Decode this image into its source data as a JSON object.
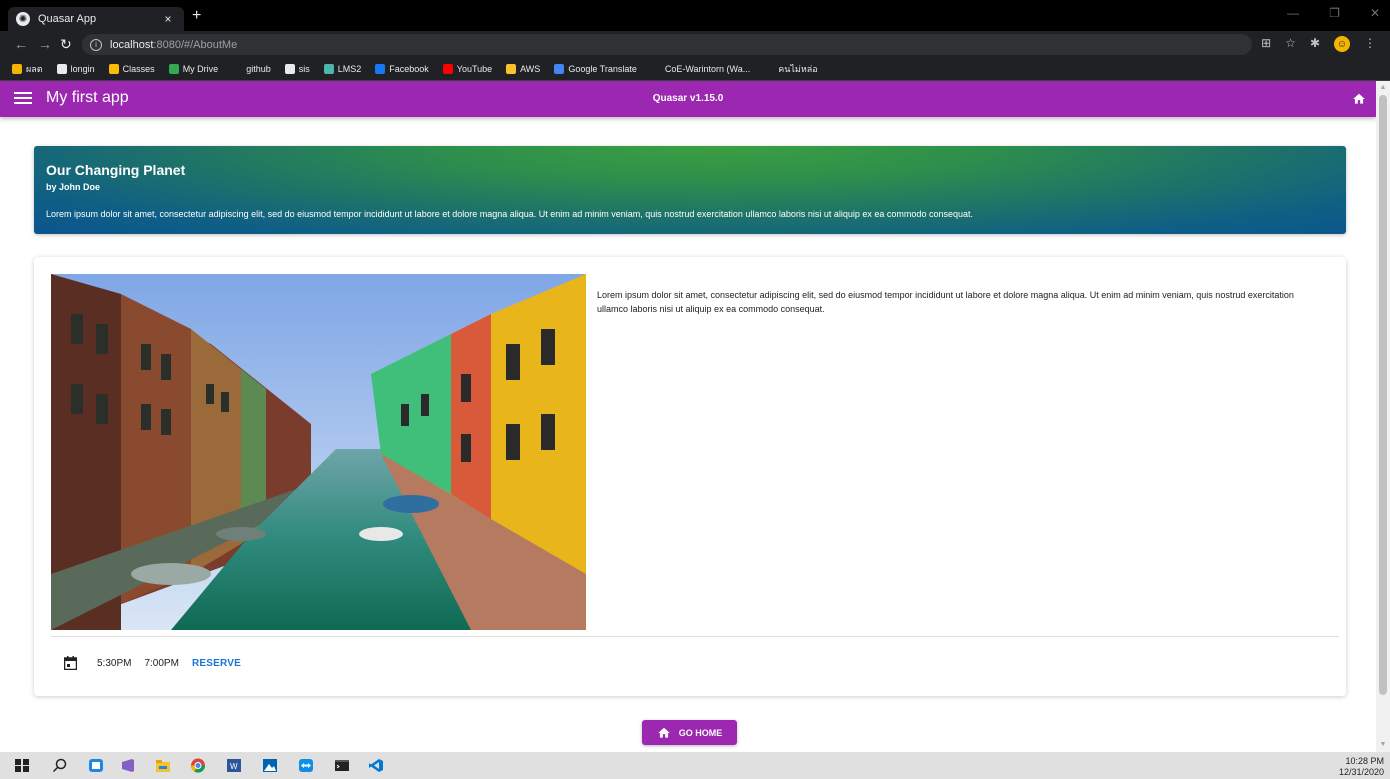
{
  "browser": {
    "tab_title": "Quasar App",
    "tab_close": "×",
    "new_tab": "+",
    "url_host": "localhost",
    "url_rest": ":8080/#/AboutMe",
    "bookmarks": [
      {
        "label": "ผลต",
        "color": "#f4b400"
      },
      {
        "label": "longin",
        "color": "#e8eaed"
      },
      {
        "label": "Classes",
        "color": "#fbbc04"
      },
      {
        "label": "My Drive",
        "color": "#34a853"
      },
      {
        "label": "github",
        "color": "#202124"
      },
      {
        "label": "sis",
        "color": "#e8eaed"
      },
      {
        "label": "LMS2",
        "color": "#4db6ac"
      },
      {
        "label": "Facebook",
        "color": "#1877f2"
      },
      {
        "label": "YouTube",
        "color": "#ff0000"
      },
      {
        "label": "AWS",
        "color": "#fbc02d"
      },
      {
        "label": "Google Translate",
        "color": "#4285f4"
      },
      {
        "label": "CoE-Warintorn (Wa...",
        "color": "#202124"
      },
      {
        "label": "คนไม่หล่อ",
        "color": "#202124"
      }
    ]
  },
  "header": {
    "title": "My first app",
    "version": "Quasar v1.15.0"
  },
  "banner": {
    "title": "Our Changing Planet",
    "subtitle": "by John Doe",
    "text": "Lorem ipsum dolor sit amet, consectetur adipiscing elit, sed do eiusmod tempor incididunt ut labore et dolore magna aliqua. Ut enim ad minim veniam, quis nostrud exercitation ullamco laboris nisi ut aliquip ex ea commodo consequat."
  },
  "card": {
    "text": "Lorem ipsum dolor sit amet, consectetur adipiscing elit, sed do eiusmod tempor incididunt ut labore et dolore magna aliqua. Ut enim ad minim veniam, quis nostrud exercitation ullamco laboris nisi ut aliquip ex ea commodo consequat.",
    "time_1": "5:30PM",
    "time_2": "7:00PM",
    "reserve_label": "RESERVE"
  },
  "go_home_label": "GO HOME",
  "taskbar": {
    "time": "10:28 PM",
    "date": "12/31/2020"
  },
  "colors": {
    "primary": "#9c27b0",
    "link": "#1976d2"
  }
}
